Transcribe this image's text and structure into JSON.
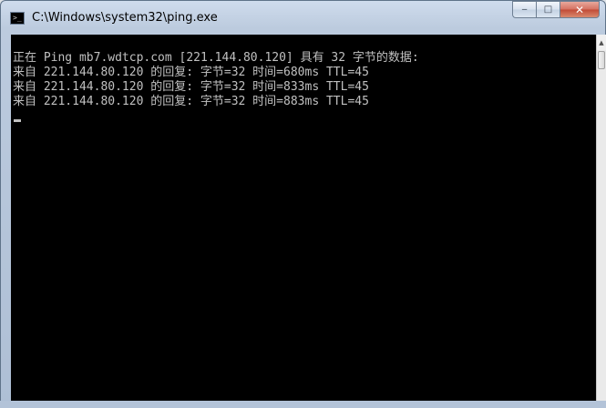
{
  "window": {
    "title": "C:\\Windows\\system32\\ping.exe",
    "controls": {
      "minimize": "‒",
      "maximize": "□",
      "close": "✕"
    }
  },
  "app_icon": {
    "name": "console-icon",
    "glyph": ">_"
  },
  "console": {
    "lines": [
      "正在 Ping mb7.wdtcp.com [221.144.80.120] 具有 32 字节的数据:",
      "来自 221.144.80.120 的回复: 字节=32 时间=680ms TTL=45",
      "来自 221.144.80.120 的回复: 字节=32 时间=833ms TTL=45",
      "来自 221.144.80.120 的回复: 字节=32 时间=883ms TTL=45"
    ]
  },
  "scrollbar": {
    "up_arrow": "▲"
  },
  "colors": {
    "console_bg": "#000000",
    "console_text": "#c0c0c0",
    "close_button": "#c14a36"
  }
}
